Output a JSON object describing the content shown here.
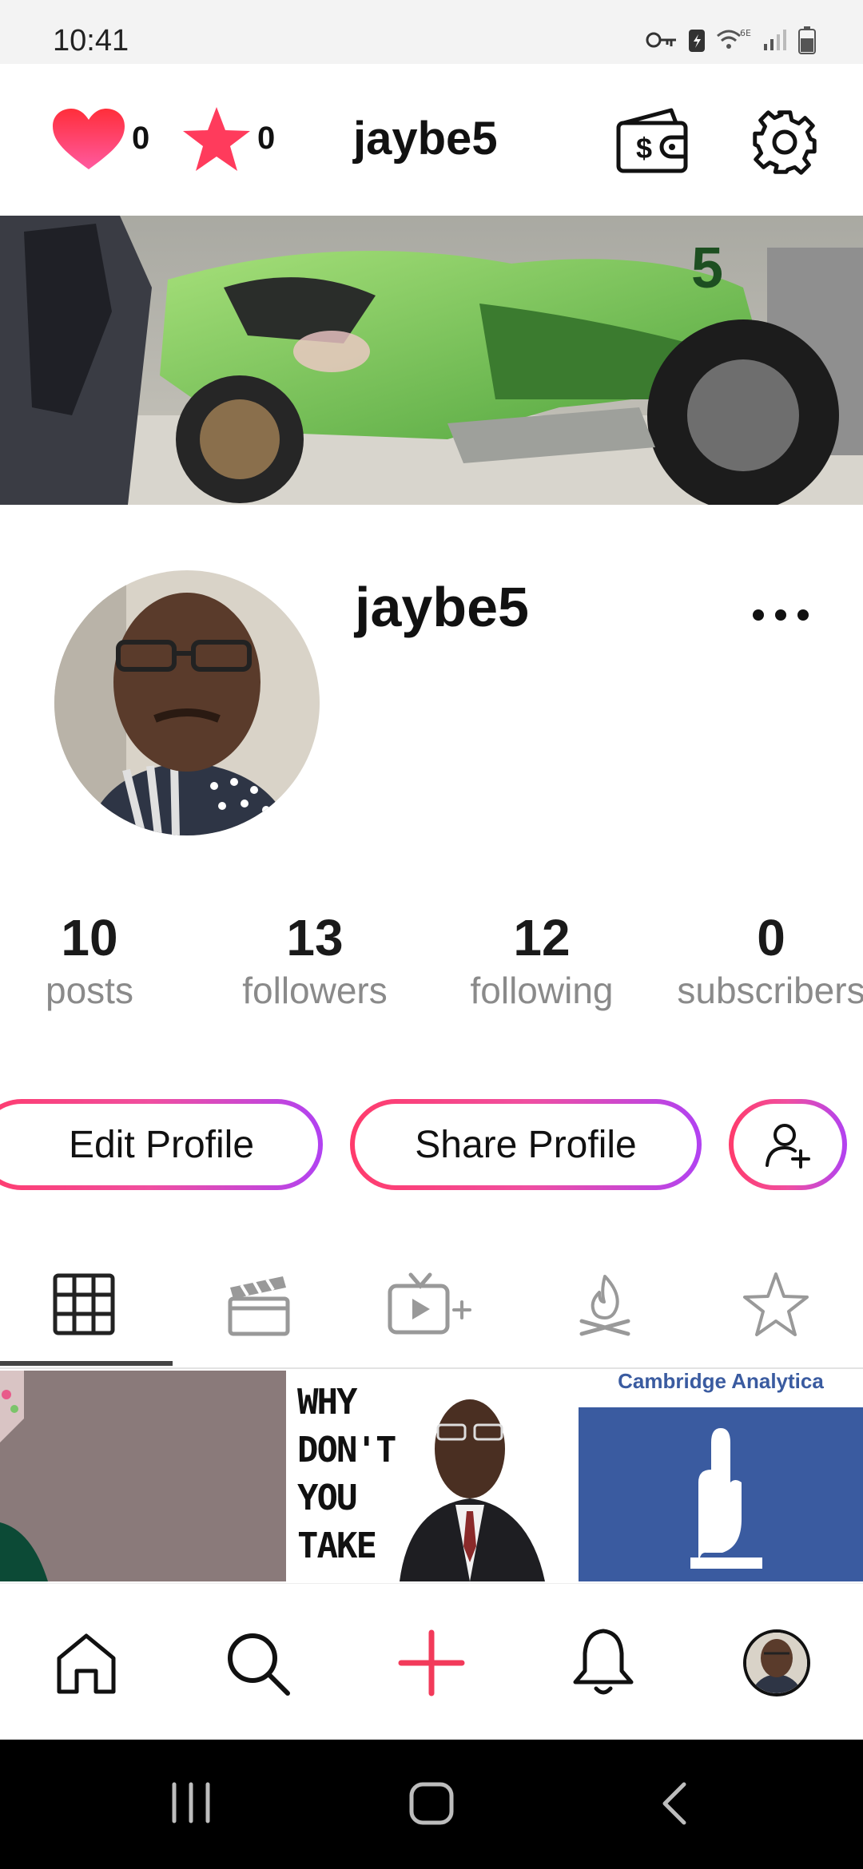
{
  "status_bar": {
    "time": "10:41"
  },
  "header": {
    "likes_count": "0",
    "stars_count": "0",
    "username": "jaybe5",
    "icons": [
      "heart-icon",
      "star-icon",
      "wallet-icon",
      "gear-icon"
    ]
  },
  "profile": {
    "username": "jaybe5",
    "stats": [
      {
        "value": "10",
        "label": "posts"
      },
      {
        "value": "13",
        "label": "followers"
      },
      {
        "value": "12",
        "label": "following"
      },
      {
        "value": "0",
        "label": "subscribers"
      }
    ],
    "edit_label": "Edit Profile",
    "share_label": "Share Profile"
  },
  "tabs": [
    {
      "name": "grid",
      "icon": "grid-icon",
      "active": true
    },
    {
      "name": "clips",
      "icon": "clapperboard-icon",
      "active": false
    },
    {
      "name": "tv",
      "icon": "tv-plus-icon",
      "active": false
    },
    {
      "name": "campfire",
      "icon": "campfire-icon",
      "active": false
    },
    {
      "name": "favorites",
      "icon": "star-outline-icon",
      "active": false
    }
  ],
  "grid_posts": [
    {
      "caption": ""
    },
    {
      "caption": "WHY DON'T YOU TAKE"
    },
    {
      "caption": "Cambridge Analytica"
    }
  ],
  "bottom_nav": [
    "home-icon",
    "search-icon",
    "add-icon",
    "bell-icon",
    "avatar"
  ],
  "colors": {
    "accent_red": "#f23a5a",
    "gradient_start": "#ff3b6b",
    "gradient_end": "#b142f2",
    "star": "#ff3b5c",
    "facebook_blue": "#3a5ba0"
  }
}
